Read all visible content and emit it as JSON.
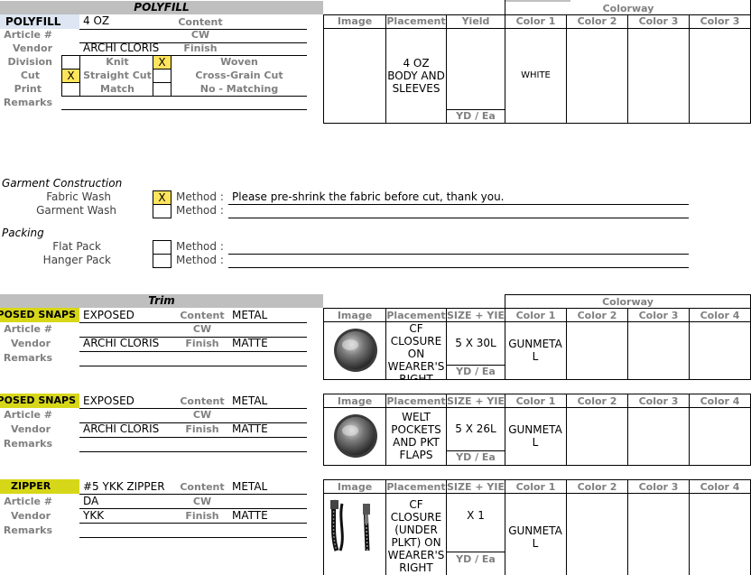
{
  "fabric": {
    "section_title": "POLYFILL",
    "colorway_label": "Colorway",
    "name": "POLYFILL",
    "weight": "4 OZ",
    "labels": {
      "content": "Content",
      "cw": "CW",
      "finish": "Finish",
      "article": "Article #",
      "vendor": "Vendor",
      "division": "Division",
      "cut": "Cut",
      "print": "Print",
      "remarks": "Remarks",
      "knit": "Knit",
      "woven": "Woven",
      "straight_cut": "Straight Cut",
      "cross_grain_cut": "Cross-Grain Cut",
      "match": "Match",
      "no_matching": "No - Matching"
    },
    "vendor": "ARCHI CLORIS",
    "division_checks": {
      "knit": "",
      "woven": "X"
    },
    "cut_checks": {
      "straight": "X",
      "cross": ""
    },
    "print_checks": {
      "match": "",
      "no_match": ""
    },
    "table_headers": [
      "Image",
      "Placement",
      "Yield",
      "Color 1",
      "Color 2",
      "Color 3",
      "Color 3"
    ],
    "placement": "4 OZ BODY AND SLEEVES",
    "yield_unit": "YD / Ea",
    "color1": "WHITE"
  },
  "construction": {
    "title": "Garment Construction",
    "fabric_wash": "Fabric Wash",
    "garment_wash": "Garment Wash",
    "fabric_wash_check": "X",
    "garment_wash_check": "",
    "method_label": "Method :",
    "fabric_wash_method": "Please pre-shrink the fabric before cut, thank you.",
    "garment_wash_method": ""
  },
  "packing": {
    "title": "Packing",
    "flat_pack": "Flat Pack",
    "hanger_pack": "Hanger Pack",
    "method_label": "Method :"
  },
  "trim": {
    "section_title": "Trim",
    "colorway_label": "Colorway",
    "labels": {
      "content": "Content",
      "cw": "CW",
      "finish": "Finish",
      "article": "Article #",
      "vendor": "Vendor",
      "remarks": "Remarks",
      "yield_unit": "YD / Ea"
    },
    "headers": [
      "Image",
      "Placement",
      "SIZE + YIELD",
      "Color 1",
      "Color 2",
      "Color 3",
      "Color 4"
    ],
    "items": [
      {
        "name": "EXPOSED SNAPS",
        "desc": "EXPOSED",
        "content": "METAL",
        "article": "",
        "cw": "",
        "vendor": "ARCHI CLORIS",
        "finish": "MATTE",
        "placement": "CF CLOSURE ON WEARER'S RIGHT",
        "size_yield": "5 X 30L",
        "color1": "GUNMETAL",
        "image": "snap-image"
      },
      {
        "name": "EXPOSED SNAPS",
        "desc": "EXPOSED",
        "content": "METAL",
        "article": "",
        "cw": "",
        "vendor": "ARCHI CLORIS",
        "finish": "MATTE",
        "placement": "WELT POCKETS AND PKT FLAPS",
        "size_yield": "5 X 26L",
        "color1": "GUNMETAL",
        "image": "snap-image"
      },
      {
        "name": "ZIPPER",
        "desc": "#5 YKK ZIPPER",
        "content": "METAL",
        "article": "DA",
        "cw": "",
        "vendor": "YKK",
        "finish": "MATTE",
        "placement": "CF CLOSURE (UNDER PLKT) ON WEARER'S RIGHT",
        "size_yield": "X 1",
        "color1": "GUNMETAL",
        "image": "zipper-image"
      }
    ]
  },
  "colors": {
    "section_gray": "#bfbfbf",
    "highlight_yellow": "#d7d719",
    "check_yellow": "#ffe45c",
    "label_gray": "#808080"
  }
}
